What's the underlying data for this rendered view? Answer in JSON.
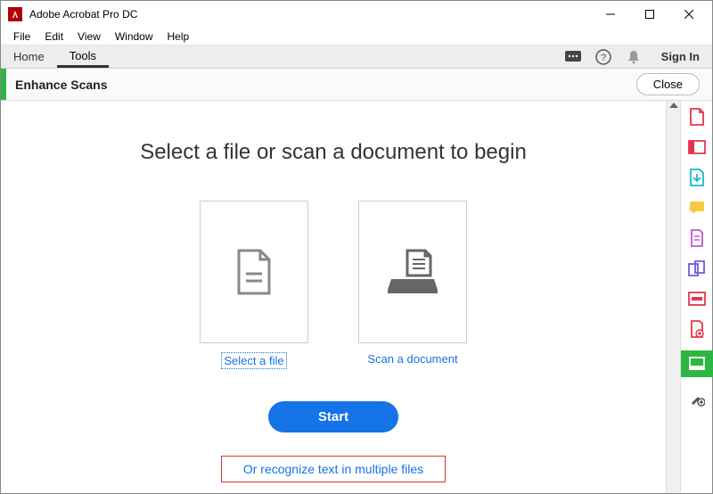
{
  "window": {
    "title": "Adobe Acrobat Pro DC"
  },
  "menu": {
    "items": [
      "File",
      "Edit",
      "View",
      "Window",
      "Help"
    ]
  },
  "tabs": {
    "home": "Home",
    "tools": "Tools",
    "signin": "Sign In"
  },
  "toolheader": {
    "title": "Enhance Scans",
    "close": "Close"
  },
  "main": {
    "heading": "Select a file or scan a document to begin",
    "select_file": "Select a file",
    "scan_doc": "Scan a document",
    "start": "Start",
    "multi": "Or recognize text in multiple files"
  },
  "colors": {
    "accent_green": "#2db742",
    "accent_blue": "#1473e6",
    "highlight_red": "#d33"
  }
}
